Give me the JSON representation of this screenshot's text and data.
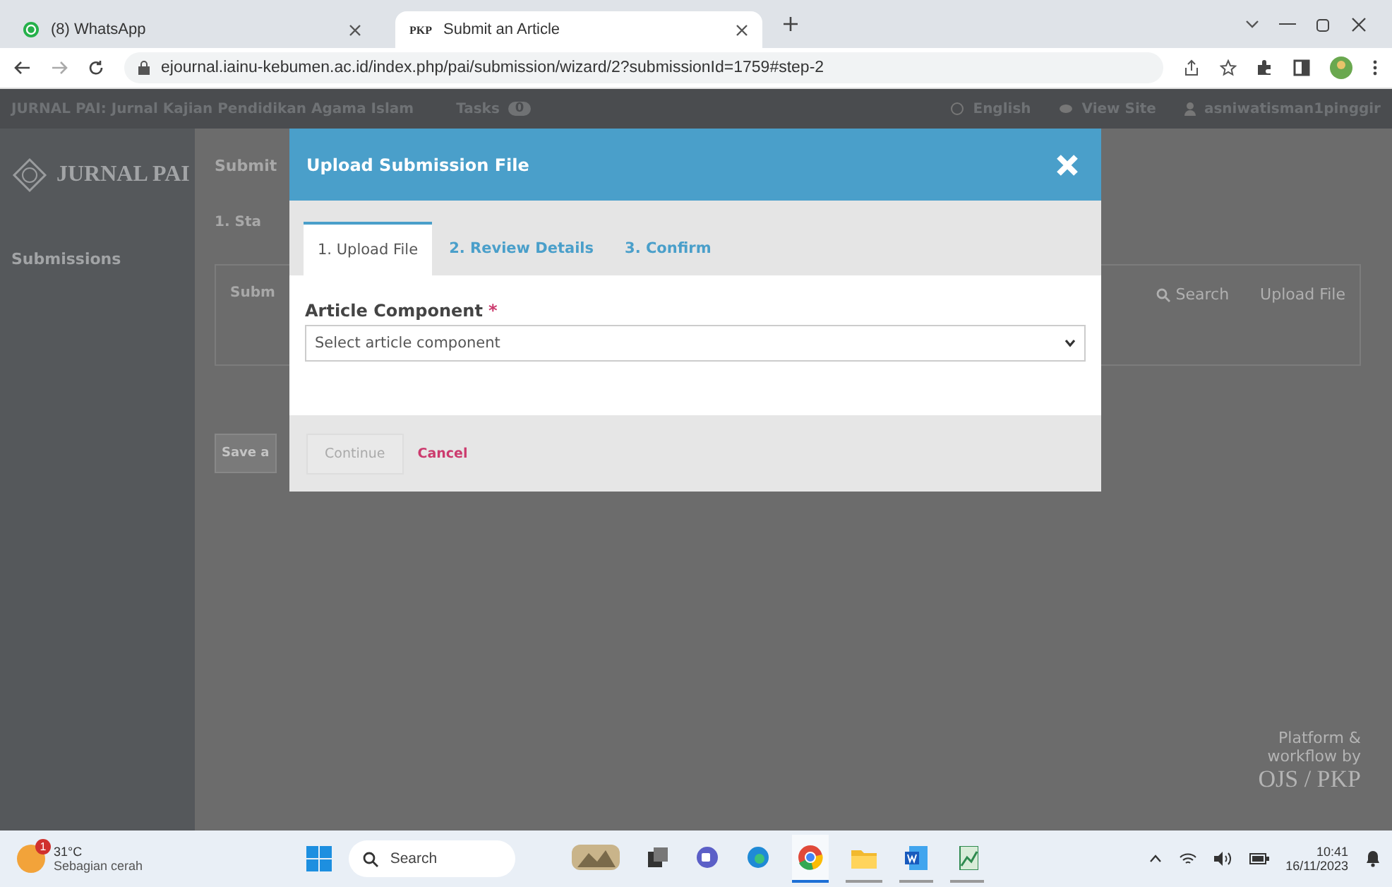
{
  "browser": {
    "tabs": [
      {
        "title": "(8) WhatsApp",
        "selected": false
      },
      {
        "title": "Submit an Article",
        "favicon": "PKP",
        "selected": true
      }
    ],
    "url": "ejournal.iainu-kebumen.ac.id/index.php/pai/submission/wizard/2?submissionId=1759#step-2"
  },
  "header": {
    "site_title": "JURNAL PAI: Jurnal Kajian Pendidikan Agama Islam",
    "tasks_label": "Tasks",
    "tasks_count": "0",
    "language": "English",
    "view_site": "View Site",
    "user": "asniwatisman1pinggir"
  },
  "sidebar": {
    "logo_title": "JURNAL PAI",
    "items": [
      {
        "label": "Submissions"
      }
    ]
  },
  "main": {
    "title": "Submit",
    "steps": [
      {
        "label": "1. Sta"
      }
    ],
    "panel_title": "Subm",
    "panel_actions": [
      {
        "label": "Search",
        "kind": "search"
      },
      {
        "label": "Upload File",
        "kind": "plain"
      }
    ],
    "buttons": [
      {
        "label": "Save a"
      }
    ]
  },
  "footer": {
    "text": "Platform & workflow by",
    "brand": "OJS / PKP"
  },
  "modal": {
    "title": "Upload Submission File",
    "tabs": [
      {
        "label": "1. Upload File",
        "selected": true
      },
      {
        "label": "2. Review Details",
        "selected": false
      },
      {
        "label": "3. Confirm",
        "selected": false
      }
    ],
    "field": {
      "label": "Article Component",
      "required_mark": "*",
      "placeholder": "Select article component"
    },
    "buttons": [
      {
        "label": "Continue",
        "kind": "primary",
        "disabled": true
      },
      {
        "label": "Cancel",
        "kind": "link",
        "disabled": false
      }
    ]
  },
  "taskbar": {
    "weather": {
      "temp": "31°C",
      "condition": "Sebagian cerah",
      "badge": "1"
    },
    "search": {
      "placeholder": "Search"
    },
    "apps": [
      {
        "kind": "photo",
        "selected": false,
        "running": false
      },
      {
        "kind": "taskview",
        "selected": false,
        "running": false
      },
      {
        "kind": "chat",
        "selected": false,
        "running": false
      },
      {
        "kind": "edge",
        "selected": false,
        "running": false
      },
      {
        "kind": "browser",
        "selected": true,
        "running": true
      },
      {
        "kind": "folder",
        "selected": false,
        "running": true
      },
      {
        "kind": "word",
        "selected": false,
        "running": true
      },
      {
        "kind": "sheet",
        "selected": false,
        "running": true
      }
    ],
    "time": "10:41",
    "date": "16/11/2023"
  }
}
